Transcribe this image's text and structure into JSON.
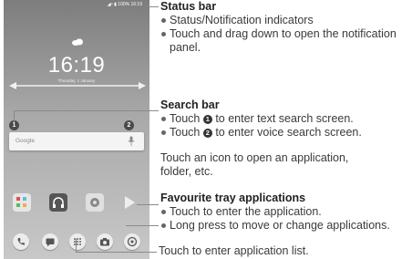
{
  "phone": {
    "status_text": "◢⁴ ▮ 100% 16:19",
    "clock": "16:19",
    "clock_sub": "Thursday, 1 January",
    "search_word": "Google",
    "badge_1": "1",
    "badge_2": "2"
  },
  "status_section": {
    "heading": "Status bar",
    "bullets": [
      "Status/Notification indicators",
      "Touch and drag down to open the notification panel."
    ]
  },
  "search_section": {
    "heading": "Search bar",
    "bullet_1_pre": "Touch ",
    "bullet_1_num": "1",
    "bullet_1_post": " to enter text search screen.",
    "bullet_2_pre": "Touch ",
    "bullet_2_num": "2",
    "bullet_2_post": " to enter voice search screen."
  },
  "icon_section": {
    "text": "Touch an icon to open an application, folder, etc."
  },
  "favourite_section": {
    "heading": "Favourite tray applications",
    "bullets": [
      "Touch to enter the application.",
      "Long press to move or change applications."
    ]
  },
  "app_list_section": {
    "text": "Touch to enter application list."
  },
  "colors": {
    "callout_line": "#8a8a8a",
    "text": "#3a3a3a",
    "phone_bg_top": "#7d7d7d"
  }
}
